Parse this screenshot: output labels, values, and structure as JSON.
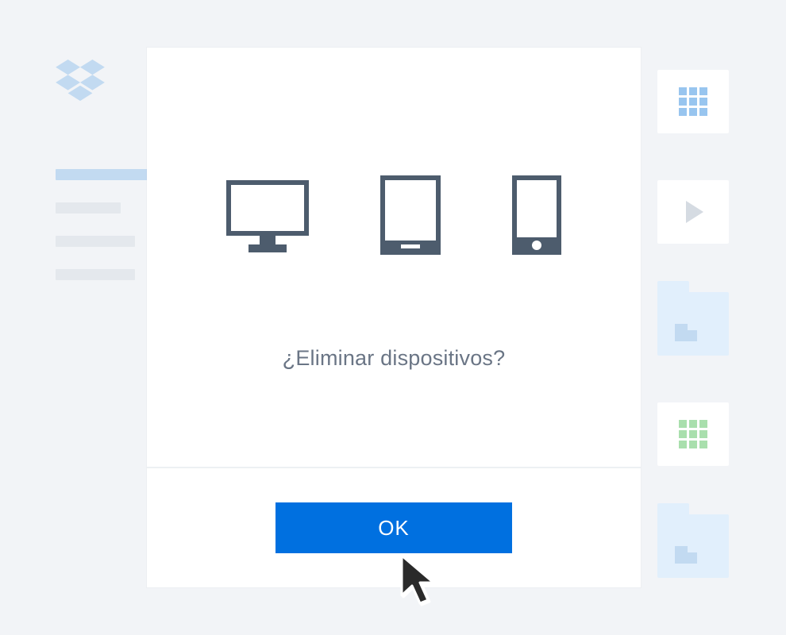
{
  "modal": {
    "title": "¿Eliminar dispositivos?",
    "confirm_label": "OK"
  },
  "colors": {
    "accent": "#0070e0",
    "modal_bg": "#ffffff",
    "page_bg": "#f2f4f7",
    "text_muted": "#6a7585",
    "icon": "#4d5c6d"
  },
  "icons": {
    "logo": "dropbox-logo",
    "devices": [
      "monitor-icon",
      "tablet-icon",
      "phone-icon"
    ]
  }
}
